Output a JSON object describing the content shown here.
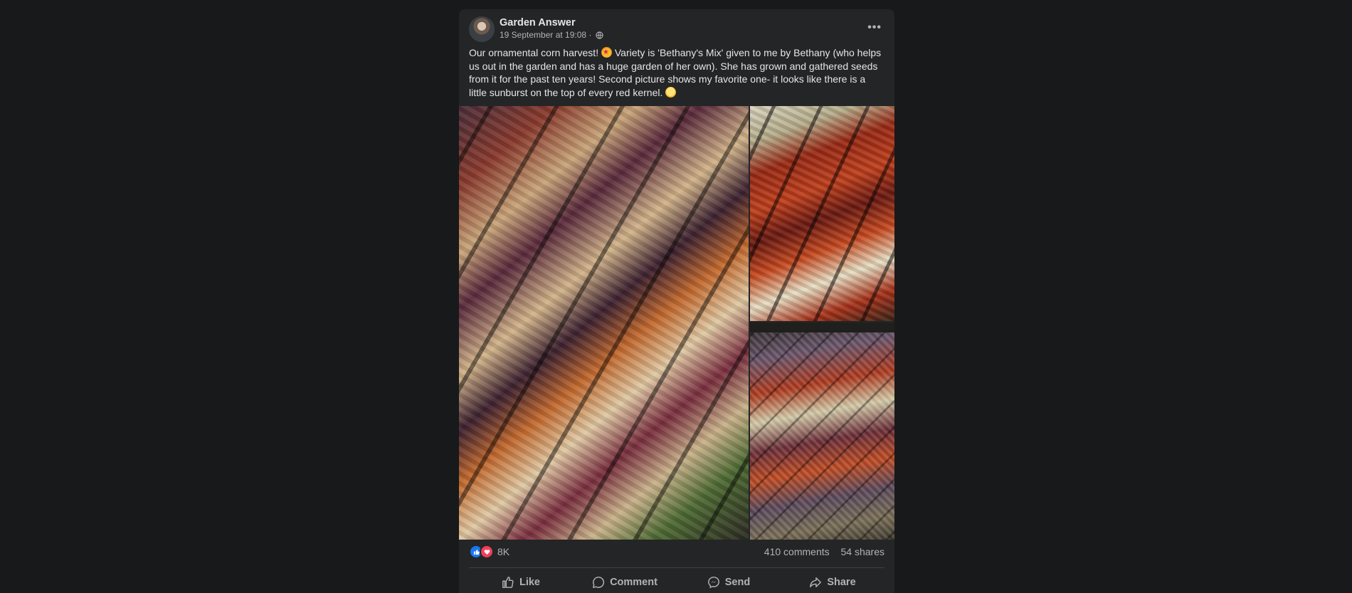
{
  "post": {
    "author": "Garden Answer",
    "timestamp": "19 September at 19:08",
    "separator": "·",
    "privacy_icon": "globe-icon",
    "more_icon": "more-options-icon",
    "text_parts": {
      "p1": "Our ornamental corn harvest! ",
      "p2": " Variety is 'Bethany's Mix' given to me by Bethany (who helps us out in the garden and has a huge garden of her own). She has grown and gathered seeds from it for the past ten years! Second picture shows my favorite one- it looks like there is a little sunburst on the top of every red kernel. "
    },
    "images": [
      {
        "alt": "Close-up of multicolored ornamental corn ears with husks"
      },
      {
        "alt": "Red and dark kernel ornamental corn ear"
      },
      {
        "alt": "Truck bed full of harvested ornamental corn"
      }
    ]
  },
  "stats": {
    "reaction_count": "8K",
    "comments": "410 comments",
    "shares": "54 shares"
  },
  "actions": {
    "like": "Like",
    "comment": "Comment",
    "send": "Send",
    "share": "Share"
  },
  "colors": {
    "background": "#18191a",
    "card": "#242526",
    "text_primary": "#e4e6eb",
    "text_secondary": "#b0b3b8",
    "like_blue": "#1877f2",
    "love_red": "#f33e58"
  }
}
